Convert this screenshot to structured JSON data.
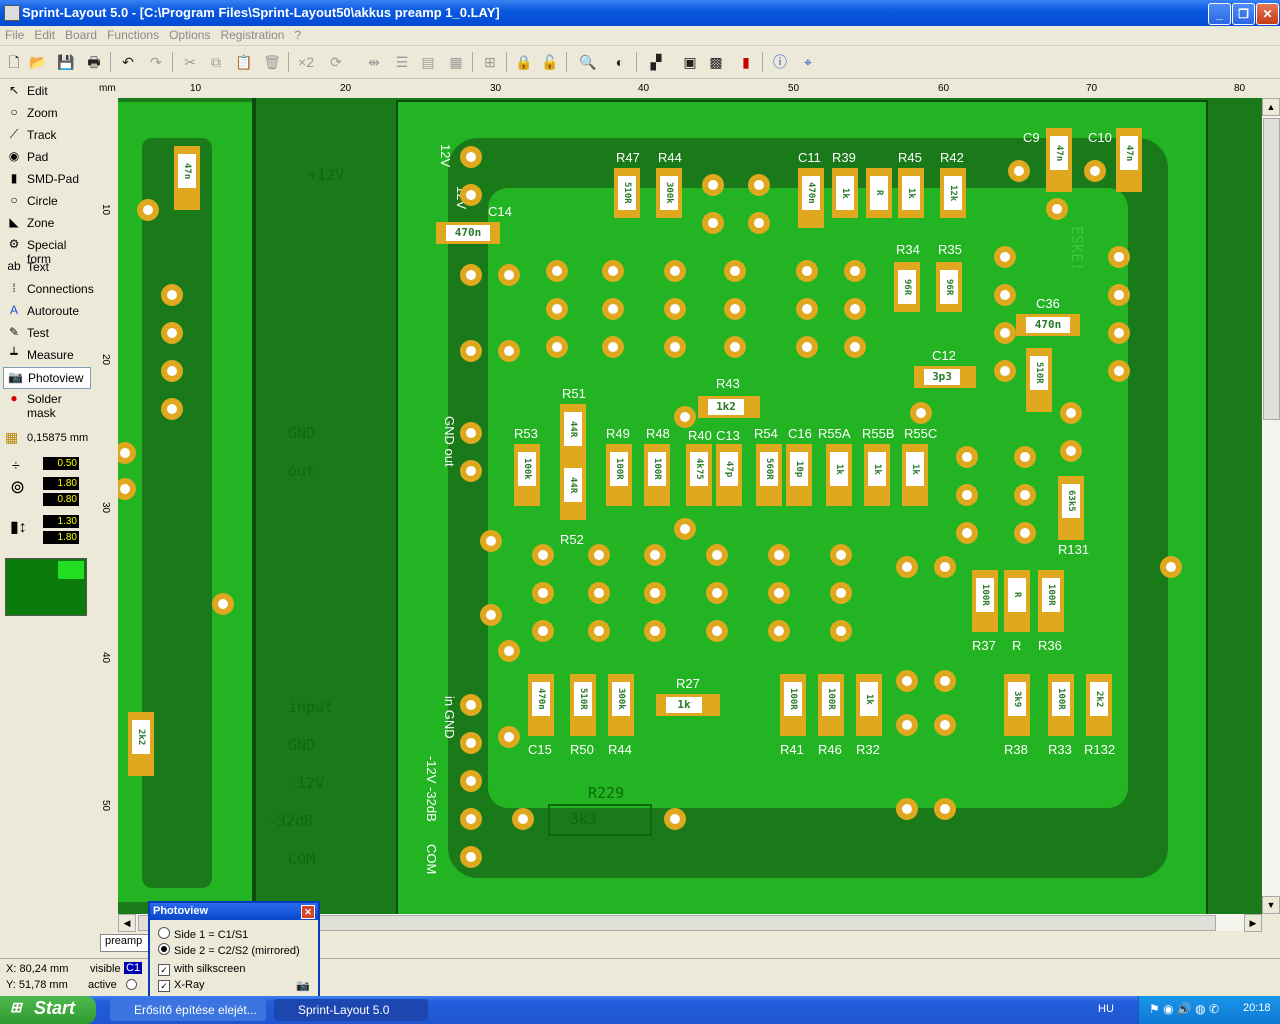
{
  "window": {
    "title": "Sprint-Layout 5.0 - [C:\\Program Files\\Sprint-Layout50\\akkus preamp 1_0.LAY]"
  },
  "menu": [
    "File",
    "Edit",
    "Board",
    "Functions",
    "Options",
    "Registration",
    "?"
  ],
  "tools": [
    {
      "label": "Edit",
      "icon": "arrow-icon"
    },
    {
      "label": "Zoom",
      "icon": "magnifier-icon"
    },
    {
      "label": "Track",
      "icon": "track-icon"
    },
    {
      "label": "Pad",
      "icon": "pad-icon"
    },
    {
      "label": "SMD-Pad",
      "icon": "smd-pad-icon"
    },
    {
      "label": "Circle",
      "icon": "circle-icon"
    },
    {
      "label": "Zone",
      "icon": "zone-icon"
    },
    {
      "label": "Special form",
      "icon": "special-form-icon"
    },
    {
      "label": "Text",
      "icon": "text-icon"
    },
    {
      "label": "Connections",
      "icon": "connections-icon"
    },
    {
      "label": "Autoroute",
      "icon": "autoroute-icon"
    },
    {
      "label": "Test",
      "icon": "test-icon"
    },
    {
      "label": "Measure",
      "icon": "measure-icon"
    },
    {
      "label": "Photoview",
      "icon": "camera-icon"
    },
    {
      "label": "Solder mask",
      "icon": "solder-mask-icon"
    }
  ],
  "grid": "0,15875 mm",
  "values": {
    "track_width": "0.50",
    "pad_outer": "1.80",
    "pad_inner": "0.80",
    "smd_w": "1.30",
    "smd_h": "1.80"
  },
  "ruler": {
    "unit": "mm",
    "h_ticks": [
      "10",
      "20",
      "30",
      "40",
      "50",
      "60",
      "70",
      "80"
    ],
    "v_ticks": [
      "10",
      "20",
      "30",
      "40",
      "50"
    ]
  },
  "board_labels": {
    "r47": "R47",
    "r44": "R44",
    "c11": "C11",
    "r39": "R39",
    "r45": "R45",
    "r42": "R42",
    "c9": "C9",
    "c10": "C10",
    "c14": "C14",
    "r34": "R34",
    "r35": "R35",
    "c36": "C36",
    "c12": "C12",
    "r51": "R51",
    "r43": "R43",
    "r53": "R53",
    "r49": "R49",
    "r48": "R48",
    "r40": "R40",
    "c13": "C13",
    "r54": "R54",
    "c16": "C16",
    "r55a": "R55A",
    "r55b": "R55B",
    "r55c": "R55C",
    "r52": "R52",
    "r131": "R131",
    "r37": "R37",
    "r": "R",
    "r36": "R36",
    "r27": "R27",
    "c15": "C15",
    "r50": "R50",
    "r44b": "R44",
    "r41": "R41",
    "r46": "R46",
    "r32": "R32",
    "r38": "R38",
    "r33": "R33",
    "r132": "R132",
    "v12a": "12V",
    "v12b": "12V",
    "gnd_out": "GND out",
    "in_gnd": "in GND",
    "neg12": "-12V -32dB",
    "com": "COM"
  },
  "smd_values": {
    "c47n_left": "47n",
    "c470n_c14": "470n",
    "r510": "510R",
    "r300k": "300k",
    "c470n_c11": "470n",
    "r1k_39": "1k",
    "rR_45": "R",
    "r1k_45": "1k",
    "r12k": "12k",
    "c47n_9": "47n",
    "c47n_10": "47n",
    "r96R_34": "96R",
    "r96R_35": "96R",
    "c470n_36": "470n",
    "r510_36": "510R",
    "c3p3": "3p3",
    "r1k2": "1k2",
    "r44R_a": "44R",
    "r44R_b": "44R",
    "r100k": "100k",
    "r100R_49": "100R",
    "r100R_48": "100R",
    "r4k75": "4k75",
    "c47p": "47p",
    "r560R": "560R",
    "c10p": "10p",
    "r1k_a": "1k",
    "r1k_b": "1k",
    "r1k_c": "1k",
    "r63k5": "63k5",
    "r100R_37": "100R",
    "rR": "R",
    "r100R_36": "100R",
    "c470n_15": "470n",
    "r510_50": "510R",
    "r300k_44": "300k",
    "r1k_27": "1k",
    "r100R_41": "100R",
    "r100R_46": "100R",
    "r1k_32": "1k",
    "r3k9": "3k9",
    "r100R_33": "100R",
    "r2k2": "2k2",
    "c2k2_left": "2k2",
    "c3k3_silk": "3k3"
  },
  "silk_text": [
    "+12V",
    "GND",
    "out",
    "input",
    "GND",
    "-12V",
    "-32dB",
    "COM",
    "ESKE!",
    "R229"
  ],
  "tab": "preamp",
  "photoview": {
    "title": "Photoview",
    "side1": "Side 1 = C1/S1",
    "side2": "Side 2 = C2/S2 (mirrored)",
    "silkscreen": "with silkscreen",
    "xray": "X-Ray"
  },
  "status": {
    "x": "X:  80,24 mm",
    "y": "Y:  51,78 mm",
    "visible": "visible",
    "active": "active",
    "layer": "C1"
  },
  "taskbar": {
    "start": "Start",
    "task1": "Erősítő építése elejét...",
    "task2": "Sprint-Layout 5.0",
    "lang": "HU",
    "clock": "20:18"
  },
  "colors": {
    "board": "#1a7a1a",
    "copper": "#22b422",
    "pad": "#e0a81e"
  }
}
